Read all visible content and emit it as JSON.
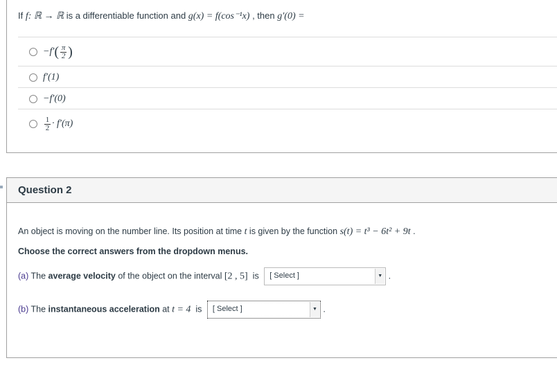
{
  "question1": {
    "prompt_pre": "If ",
    "map": "f: ℝ → ℝ",
    "prompt_mid": " is a differentiable function and ",
    "def": "g(x) = f(cos⁻¹x)",
    "prompt_then": " , then ",
    "target": "g′(0) =",
    "answers": [
      {
        "pre": "−f′",
        "num": "π",
        "den": "2"
      },
      {
        "text": "f′(1)"
      },
      {
        "text": "−f′(0)"
      },
      {
        "num": "1",
        "den": "2",
        "post": "· f′(π)"
      }
    ]
  },
  "question2": {
    "title": "Question 2",
    "intro": "An object is moving on the number line. Its position at time ",
    "t": "t",
    "intro2": " is given by the function ",
    "func": "s(t) = t³ − 6t² + 9t",
    "instruction": "Choose the correct answers from the dropdown menus.",
    "part_a": {
      "label": "(a)",
      "t1": " The ",
      "bold": "average velocity",
      "t2": " of the object on the interval ",
      "interval": "[2 , 5]",
      "t3": " is",
      "select": "[ Select ]"
    },
    "part_b": {
      "label": "(b)",
      "t1": " The ",
      "bold": "instantaneous acceleration",
      "t2": " at ",
      "cond": "t = 4",
      "t3": " is",
      "select": "[ Select ]"
    }
  },
  "colors": {
    "label": "#4a3b8f",
    "border": "#a0a0a0",
    "header_bg": "#f5f5f5"
  }
}
